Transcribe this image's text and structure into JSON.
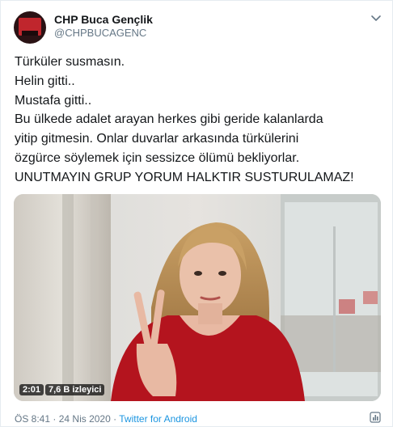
{
  "author": {
    "name": "CHP Buca Gençlik",
    "handle": "@CHPBUCAGENC"
  },
  "tweet": {
    "lines": [
      "Türküler susmasın.",
      "Helin gitti..",
      "Mustafa gitti..",
      "Bu ülkede adalet arayan herkes gibi geride kalanlarda",
      "yitip gitmesin. Onlar duvarlar arkasında türkülerini",
      "özgürce söylemek için sessizce ölümü bekliyorlar.",
      "UNUTMAYIN GRUP YORUM HALKTIR SUSTURULAMAZ!"
    ]
  },
  "video": {
    "duration": "2:01",
    "views": "7,6 B izleyici"
  },
  "meta": {
    "time": "ÖS 8:41",
    "sep1": "·",
    "date": "24 Nis 2020",
    "sep2": "·",
    "source": "Twitter for Android"
  },
  "icons": {
    "menu": "chevron-down-icon",
    "analytics": "analytics-icon",
    "avatar": "profile-avatar"
  },
  "colors": {
    "text": "#14171a",
    "secondary": "#657786",
    "link": "#1b95e0"
  }
}
